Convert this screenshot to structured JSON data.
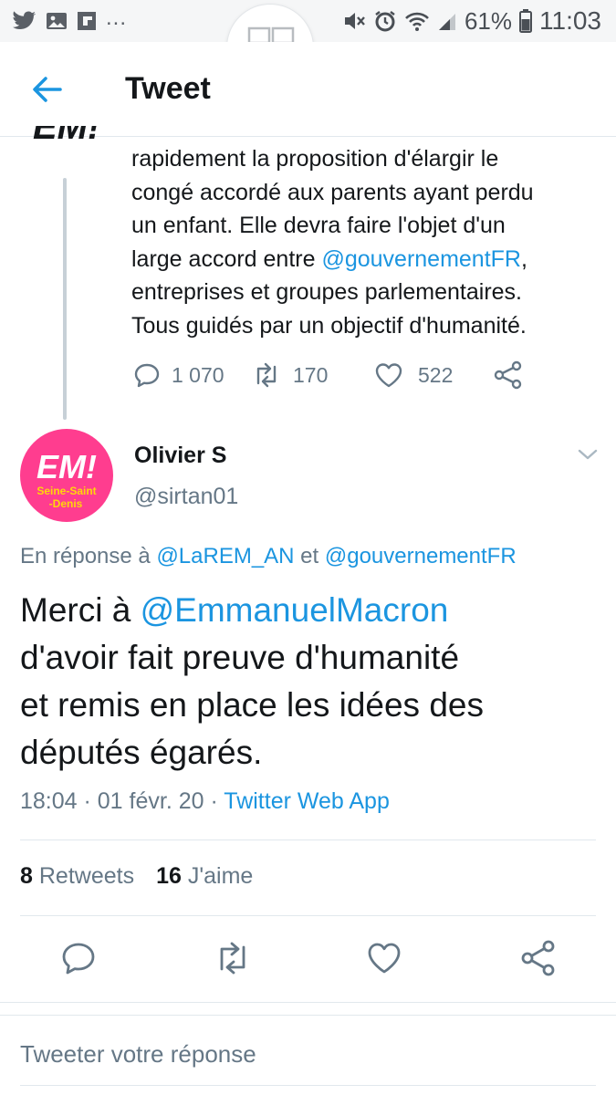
{
  "status_bar": {
    "icons_left": [
      "twitter-icon",
      "gallery-icon",
      "flipboard-icon"
    ],
    "more": "...",
    "battery_percent": "61%",
    "time": "11:03"
  },
  "app_bar": {
    "title": "Tweet"
  },
  "parent_tweet": {
    "lines": [
      {
        "text": "rapidement la proposition d'élargir le"
      },
      {
        "text": "congé accordé aux parents ayant perdu"
      },
      {
        "text": "un enfant. Elle devra faire l'objet d'un"
      },
      {
        "pre": "large accord entre ",
        "mention": "@gouvernementFR",
        "post": ","
      },
      {
        "text": "entreprises et groupes parlementaires."
      },
      {
        "text": "Tous guidés par un objectif d'humanité."
      }
    ],
    "replies": "1 070",
    "retweets": "170",
    "likes": "522"
  },
  "reply_tweet": {
    "avatar": {
      "main": "EM!",
      "sub1": "Seine-Saint",
      "sub2": "-Denis"
    },
    "name": "Olivier S",
    "handle": "@sirtan01",
    "reply_to": {
      "prefix": "En réponse à ",
      "first": "@LaREM_AN",
      "joiner": " et ",
      "second": "@gouvernementFR"
    },
    "body": {
      "line1_pre": "Merci à ",
      "line1_mention": "@EmmanuelMacron",
      "line2": "d'avoir fait preuve d'humanité",
      "line3": "et remis en place les idées des",
      "line4": "députés égarés."
    },
    "time": "18:04",
    "date": "01 févr. 20",
    "source": "Twitter Web App",
    "retweets_count": "8",
    "retweets_label": "Retweets",
    "likes_count": "16",
    "likes_label": "J'aime"
  },
  "compose": {
    "placeholder": "Tweeter votre réponse"
  },
  "colors": {
    "accent": "#1b95e0",
    "muted": "#657786",
    "avatar": "#ff3d8f"
  }
}
